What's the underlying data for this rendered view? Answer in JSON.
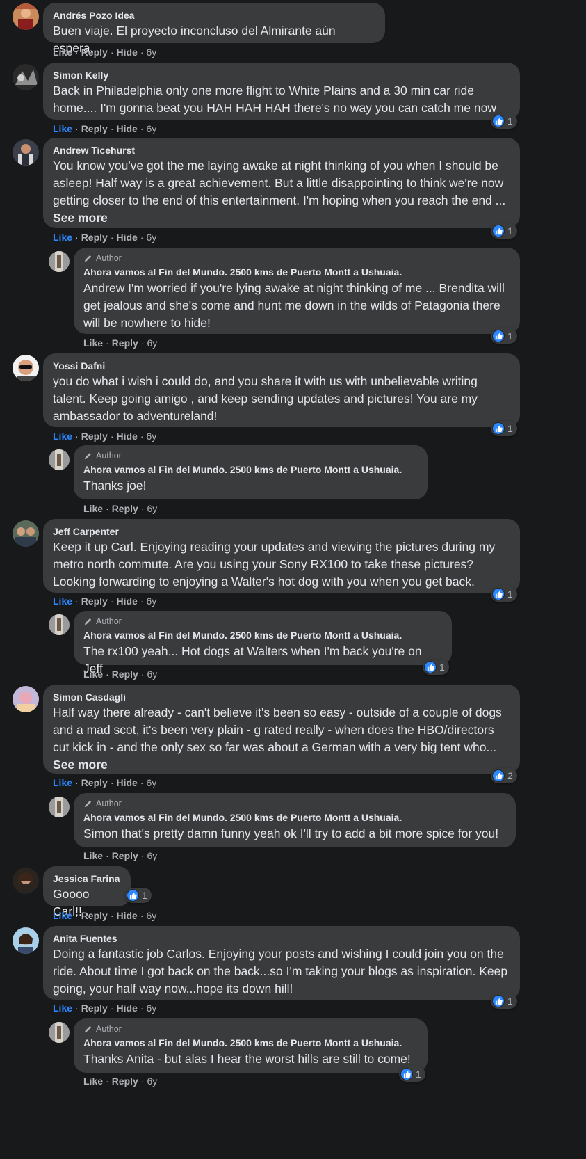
{
  "actions": {
    "like": "Like",
    "reply": "Reply",
    "hide": "Hide",
    "sep": "·"
  },
  "author_badge": "Author",
  "post_title": "Ahora vamos al Fin del Mundo. 2500 kms de Puerto Montt a Ushuaia.",
  "colors": {
    "background": "#18191a",
    "bubble": "#3a3b3c",
    "text": "#e4e6eb",
    "muted": "#b0b3b8",
    "like_blue": "#2d88ff"
  },
  "comments": [
    {
      "name": "Andrés Pozo Idea",
      "text": "Buen viaje. El proyecto inconcluso del Almirante aún espera.",
      "time": "6y",
      "liked": false,
      "reactions": ""
    },
    {
      "name": "Simon Kelly",
      "text": "Back in Philadelphia only one more flight to White Plains and a 30 min car ride home.... I'm gonna beat you HAH HAH HAH there's no way you can catch me now",
      "time": "6y",
      "liked": true,
      "reactions": "1"
    },
    {
      "name": "Andrew Ticehurst",
      "text": "You know you've got the me laying awake at night thinking of you when I should be asleep! Half way is a great achievement. But a little disappointing to think we're now getting closer to the end of this entertainment. I'm hoping when you reach the end ...",
      "see_more": "See more",
      "time": "6y",
      "liked": true,
      "reactions": "1"
    },
    {
      "name": "Yossi Dafni",
      "text": "you do what i wish i could do, and you share it with us with unbelievable writing talent. Keep going amigo , and keep sending updates and pictures! You are my ambassador to adventureland!",
      "time": "6y",
      "liked": true,
      "reactions": "1"
    },
    {
      "name": "Jeff Carpenter",
      "text": "Keep it up Carl. Enjoying reading your updates and viewing the pictures during my metro north commute. Are you using your Sony RX100 to take these pictures? Looking forwarding to enjoying a Walter's hot dog with you when you get back.",
      "time": "6y",
      "liked": true,
      "reactions": "1"
    },
    {
      "name": "Simon Casdagli",
      "text": "Half way there already - can't believe it's been so easy - outside of a couple of dogs and a mad scot, it's been very plain - g rated really - when does the HBO/directors cut kick in - and the only sex so far was about a German with a very big tent who...",
      "see_more": "See more",
      "time": "6y",
      "liked": true,
      "reactions": "2"
    },
    {
      "name": "Jessica Farina",
      "text": "Goooo Carl!!",
      "time": "6y",
      "liked": true,
      "reactions": "1"
    },
    {
      "name": "Anita Fuentes",
      "text": "Doing a fantastic job Carlos. Enjoying your posts and wishing I could join you on the ride. About time I got back on the back...so I'm taking your blogs as inspiration. Keep going, your half way now...hope its down hill!",
      "time": "6y",
      "liked": true,
      "reactions": "1"
    }
  ],
  "replies": [
    {
      "text": "Andrew I'm worried if you're lying awake at night thinking of me ... Brendita will get jealous and she's come and hunt me down in the wilds of Patagonia there will be nowhere to hide!",
      "time": "6y",
      "reactions": "1"
    },
    {
      "text": "Thanks joe!",
      "time": "6y",
      "reactions": ""
    },
    {
      "text": "The rx100 yeah... Hot dogs at Walters when I'm back you're on Jeff",
      "time": "6y",
      "reactions": "1"
    },
    {
      "text": "Simon that's pretty damn funny yeah ok I'll try to add a bit more spice for you!",
      "time": "6y",
      "reactions": ""
    },
    {
      "text": "Thanks Anita - but alas I hear the worst hills are still to come!",
      "time": "6y",
      "reactions": "1"
    }
  ]
}
